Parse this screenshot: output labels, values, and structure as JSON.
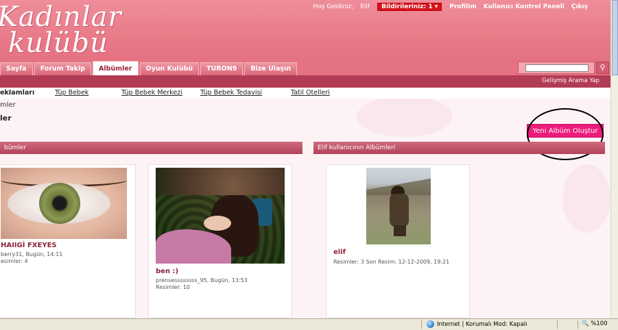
{
  "header": {
    "logo_line1": "Kadınlar",
    "logo_line2": "kulübü",
    "welcome": "Hoş Geldiniz,",
    "username": "Elif",
    "notifications": "Bildirileriniz: 1 ▾",
    "profile": "Profilim",
    "control_panel": "Kullanıcı Kontrol Paneli",
    "logout": "Çıkış"
  },
  "nav": {
    "tabs": [
      "Sayfa",
      "Forum Takip",
      "Albümler",
      "Oyun Kulübü",
      "TURON9",
      "Bize Ulaşın"
    ],
    "active_index": 2,
    "search_placeholder": "",
    "advanced_search": "Gelişmiş Arama Yap"
  },
  "links": [
    "ekIamları",
    "Tüp Bebek",
    "Tüp Bebek Merkezi",
    "Tüp Bebek Tedavisi",
    "Tatil Otelleri"
  ],
  "breadcrumb": "mler",
  "page_title": "ler",
  "new_album_button": "Yeni Albüm Oluştur",
  "sections": {
    "left": "bümler",
    "right": "Elif kullanıcının Albümleri"
  },
  "cards": [
    {
      "title": "HAIIGİ FXEYES",
      "meta1": "berry31, Bugün, 14:11",
      "meta2": "esimler: 4"
    },
    {
      "title": "ben :)",
      "meta1": "prensessssssss_95, Bugün, 13:53",
      "meta2": "Resimler: 10"
    },
    {
      "title": "elif",
      "meta1": "Resimler: 3 Son Resim: 12-12-2009, 19:21",
      "meta2": ""
    }
  ],
  "statusbar": {
    "zone": "Internet | Korumalı Mod: Kapalı",
    "zoom": "%100"
  },
  "colors": {
    "header_pink": "#e97b89",
    "dark_bar": "#b23c54",
    "button_magenta": "#ec1c7a",
    "title_maroon": "#8c2238"
  }
}
